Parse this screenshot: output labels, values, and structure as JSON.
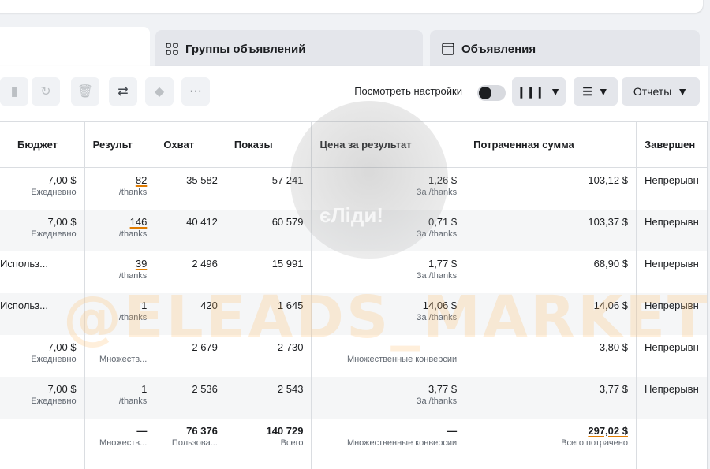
{
  "tabs": {
    "ad_sets": "Группы объявлений",
    "ads": "Объявления"
  },
  "toolbar": {
    "view_settings": "Посмотреть настройки",
    "more": "···",
    "reports": "Отчеты"
  },
  "columns": [
    "Бюджет",
    "Результ",
    "Охват",
    "Показы",
    "Цена за результат",
    "Потраченная сумма",
    "Завершен"
  ],
  "rows": [
    {
      "budget": "7,00 $",
      "budget_sub": "Ежедневно",
      "result": "82",
      "result_sub": "/thanks",
      "reach": "35 582",
      "impressions": "57 241",
      "cpr": "1,26 $",
      "cpr_sub": "За /thanks",
      "spent": "103,12 $",
      "ends": "Непрерывн"
    },
    {
      "budget": "7,00 $",
      "budget_sub": "Ежедневно",
      "result": "146",
      "result_sub": "/thanks",
      "reach": "40 412",
      "impressions": "60 579",
      "cpr": "0,71 $",
      "cpr_sub": "За /thanks",
      "spent": "103,37 $",
      "ends": "Непрерывн"
    },
    {
      "budget": "Использ...",
      "budget_sub": "",
      "result": "39",
      "result_sub": "/thanks",
      "reach": "2 496",
      "impressions": "15 991",
      "cpr": "1,77 $",
      "cpr_sub": "За /thanks",
      "spent": "68,90 $",
      "ends": "Непрерывн"
    },
    {
      "budget": "Использ...",
      "budget_sub": "",
      "result": "1",
      "result_sub": "/thanks",
      "reach": "420",
      "impressions": "1 645",
      "cpr": "14,06 $",
      "cpr_sub": "За /thanks",
      "spent": "14,06 $",
      "ends": "Непрерывн"
    },
    {
      "budget": "7,00 $",
      "budget_sub": "Ежедневно",
      "result": "—",
      "result_sub": "Множеств...",
      "reach": "2 679",
      "impressions": "2 730",
      "cpr": "—",
      "cpr_sub": "Множественные конверсии",
      "spent": "3,80 $",
      "ends": "Непрерывн"
    },
    {
      "budget": "7,00 $",
      "budget_sub": "Ежедневно",
      "result": "1",
      "result_sub": "/thanks",
      "reach": "2 536",
      "impressions": "2 543",
      "cpr": "3,77 $",
      "cpr_sub": "За /thanks",
      "spent": "3,77 $",
      "ends": "Непрерывн"
    }
  ],
  "totals": {
    "result": "—",
    "result_sub": "Множеств...",
    "reach": "76 376",
    "reach_sub": "Пользова...",
    "impressions": "140 729",
    "impressions_sub": "Всего",
    "cpr": "—",
    "cpr_sub": "Множественные конверсии",
    "spent": "297,02 $",
    "spent_sub": "Всего потрачено"
  },
  "watermark": "@ELEADS_MARKETING",
  "avatar_text": "єЛіди!",
  "colors": {
    "accent_underline": "#e07b00",
    "row_alt": "#f5f6f7",
    "border": "#dadde1"
  }
}
